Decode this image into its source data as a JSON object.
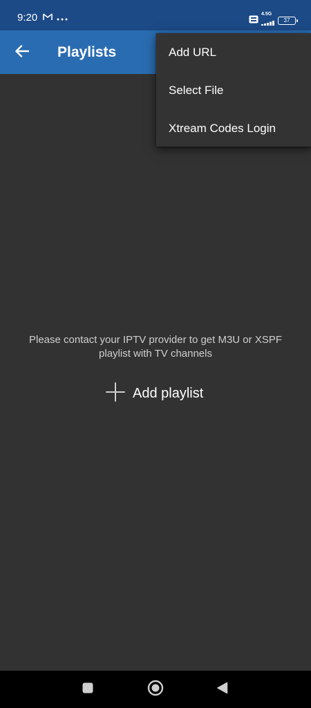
{
  "status_bar": {
    "time": "9:20",
    "network": "4.5G",
    "battery": "37",
    "icons": [
      "gmail-icon",
      "more-dots-icon",
      "volte-icon",
      "signal-icon",
      "battery-icon"
    ]
  },
  "app_bar": {
    "title": "Playlists",
    "back_icon": "arrow-left-icon"
  },
  "menu": {
    "items": [
      {
        "label": "Add URL"
      },
      {
        "label": "Select File"
      },
      {
        "label": "Xtream Codes Login"
      }
    ]
  },
  "main": {
    "empty_message": "Please contact your IPTV provider to get M3U or XSPF playlist with TV channels",
    "add_playlist_label": "Add playlist",
    "add_icon": "plus-icon"
  },
  "nav_bar": {
    "icons": [
      "recents-square-icon",
      "home-circle-icon",
      "back-triangle-icon"
    ]
  },
  "colors": {
    "status_bar": "#1c4a86",
    "app_bar": "#2a6cb1",
    "background": "#323232",
    "menu": "#333333",
    "nav_bar": "#000000"
  }
}
